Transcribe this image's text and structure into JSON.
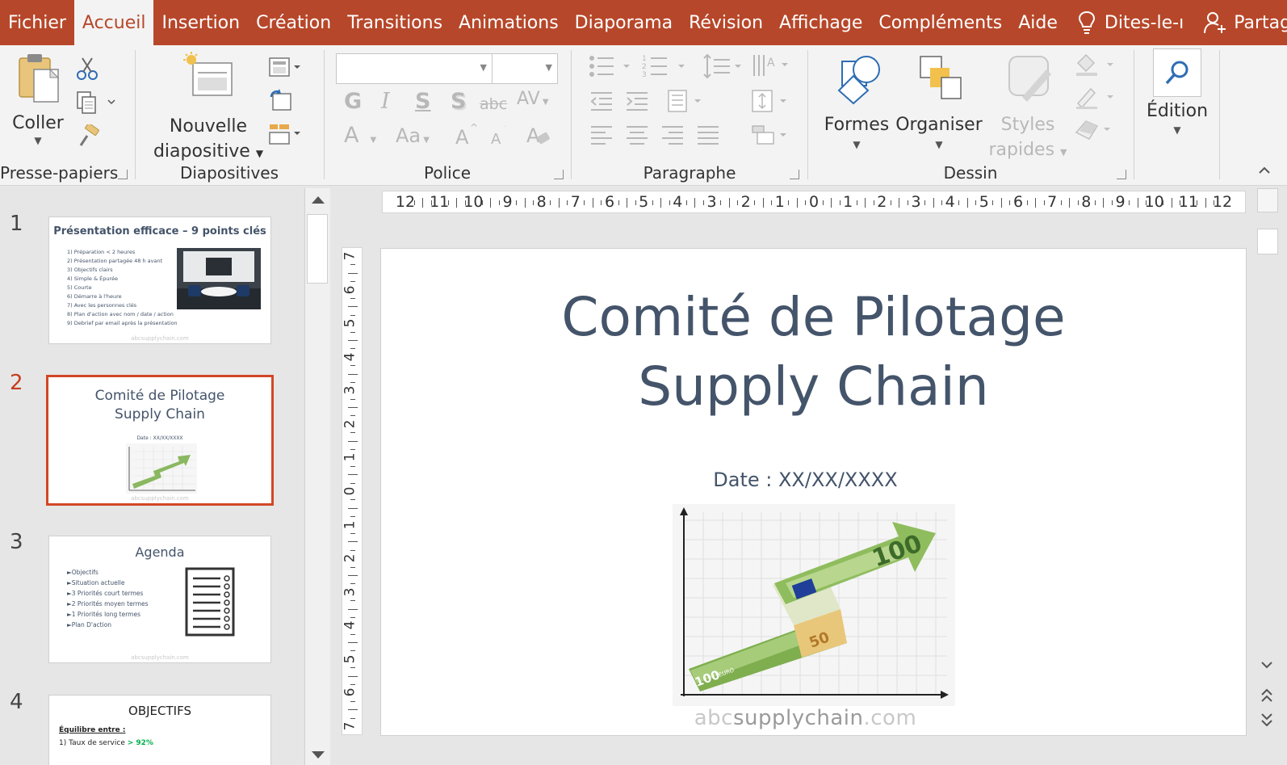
{
  "menu": {
    "tabs": [
      "Fichier",
      "Accueil",
      "Insertion",
      "Création",
      "Transitions",
      "Animations",
      "Diaporama",
      "Révision",
      "Affichage",
      "Compléments",
      "Aide"
    ],
    "active_tab": "Accueil",
    "tell_me": "Dites-le-ı",
    "share": "Partager"
  },
  "ribbon": {
    "clipboard": {
      "label": "Presse-papiers",
      "paste": "Coller"
    },
    "slides": {
      "label": "Diapositives",
      "new_slide_line1": "Nouvelle",
      "new_slide_line2": "diapositive"
    },
    "font": {
      "label": "Police",
      "bold": "G",
      "italic": "I",
      "underline": "S",
      "shadow": "S",
      "strike": "abc",
      "spacing": "AV",
      "font_color": "A",
      "case": "Aa"
    },
    "paragraph": {
      "label": "Paragraphe"
    },
    "drawing": {
      "label": "Dessin",
      "shapes": "Formes",
      "arrange": "Organiser",
      "styles_line1": "Styles",
      "styles_line2": "rapides"
    },
    "editing": {
      "label": "Édition"
    }
  },
  "ruler": {
    "horizontal": [
      "12",
      "11",
      "10",
      "9",
      "8",
      "7",
      "6",
      "5",
      "4",
      "3",
      "2",
      "1",
      "0",
      "1",
      "2",
      "3",
      "4",
      "5",
      "6",
      "7",
      "8",
      "9",
      "10",
      "11",
      "12"
    ],
    "vertical": [
      "7",
      "6",
      "5",
      "4",
      "3",
      "2",
      "1",
      "0",
      "1",
      "2",
      "3",
      "4",
      "5",
      "6",
      "7"
    ]
  },
  "thumbnails": [
    {
      "number": "1",
      "title": "Présentation efficace – 9 points clés",
      "items": [
        "1)  Préparation < 2 heures",
        "2)  Présentation partagée 48 h avant",
        "3)  Objectifs clairs",
        "4)  Simple & Épurée",
        "5)  Courte",
        "6)  Démarre à l'heure",
        "7)  Avec les personnes clés",
        "8)  Plan d'action avec nom / date / action",
        "9)  Debrief par email après la présentation"
      ],
      "footer": "abcsupplychain.com"
    },
    {
      "number": "2",
      "title_line1": "Comité de Pilotage",
      "title_line2": "Supply Chain",
      "date": "Date : XX/XX/XXXX",
      "footer": "abcsupplychain.com"
    },
    {
      "number": "3",
      "title": "Agenda",
      "items": [
        "Objectifs",
        "Situation actuelle",
        "3 Priorités court termes",
        "2 Priorités moyen termes",
        "1 Priorités long termes",
        "Plan D'action"
      ],
      "footer": "abcsupplychain.com"
    },
    {
      "number": "4",
      "title": "OBJECTIFS",
      "subtitle": "Équilibre entre :",
      "item1_prefix": "1) Taux de service ",
      "item1_value": "> 92%"
    }
  ],
  "slide": {
    "title_line1": "Comité de Pilotage",
    "title_line2": "Supply Chain",
    "date": "Date : XX/XX/XXXX",
    "footer_abc": "abc",
    "footer_supply": "supplychain",
    "footer_com": ".com",
    "banknote_a": "100",
    "banknote_b": "50",
    "banknote_c": "100",
    "banknote_euro": "EURO"
  },
  "colors": {
    "accent": "#b7472a",
    "title": "#44546a",
    "selected_border": "#d24726",
    "green": "#00b050"
  }
}
